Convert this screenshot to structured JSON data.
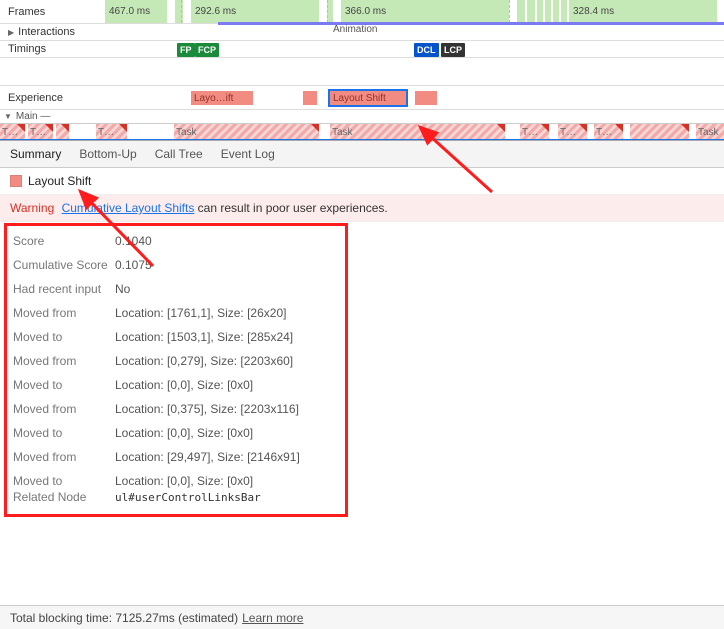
{
  "frames": {
    "label": "Frames",
    "cells": [
      "467.0 ms",
      "292.6 ms",
      "366.0 ms",
      "328.4 ms"
    ]
  },
  "interactions": {
    "label": "Interactions",
    "annotation": "Animation"
  },
  "timings": {
    "label": "Timings",
    "badges": {
      "fp": "FP",
      "fcp": "FCP",
      "dcl": "DCL",
      "lcp": "LCP"
    }
  },
  "experience": {
    "label": "Experience",
    "blocks": {
      "first": "Layo…ift",
      "selected": "Layout Shift"
    }
  },
  "main": {
    "label": "Main",
    "dash": "—",
    "tasks": [
      "T…",
      "T…",
      "T…",
      "Task",
      "Task",
      "T…",
      "T…",
      "T…",
      "Task"
    ]
  },
  "tabs": {
    "summary": "Summary",
    "bottomup": "Bottom-Up",
    "calltree": "Call Tree",
    "eventlog": "Event Log"
  },
  "summary": {
    "title": "Layout Shift",
    "warning_label": "Warning",
    "warning_link": "Cumulative Layout Shifts",
    "warning_rest": " can result in poor user experiences.",
    "rows": [
      {
        "k": "Score",
        "v": "0.1040"
      },
      {
        "k": "Cumulative Score",
        "v": "0.1075"
      },
      {
        "k": "Had recent input",
        "v": "No"
      },
      {
        "k": "Moved from",
        "v": "Location: [1761,1], Size: [26x20]"
      },
      {
        "k": "Moved to",
        "v": "Location: [1503,1], Size: [285x24]"
      },
      {
        "k": "Moved from",
        "v": "Location: [0,279], Size: [2203x60]"
      },
      {
        "k": "Moved to",
        "v": "Location: [0,0], Size: [0x0]"
      },
      {
        "k": "Moved from",
        "v": "Location: [0,375], Size: [2203x116]"
      },
      {
        "k": "Moved to",
        "v": "Location: [0,0], Size: [0x0]"
      },
      {
        "k": "Moved from",
        "v": "Location: [29,497], Size: [2146x91]"
      },
      {
        "k": "Moved to",
        "v": "Location: [0,0], Size: [0x0]"
      }
    ],
    "related_label": "Related Node",
    "related_node": "ul#userControlLinksBar"
  },
  "footer": {
    "text": "Total blocking time: 7125.27ms (estimated)",
    "link": "Learn more"
  }
}
